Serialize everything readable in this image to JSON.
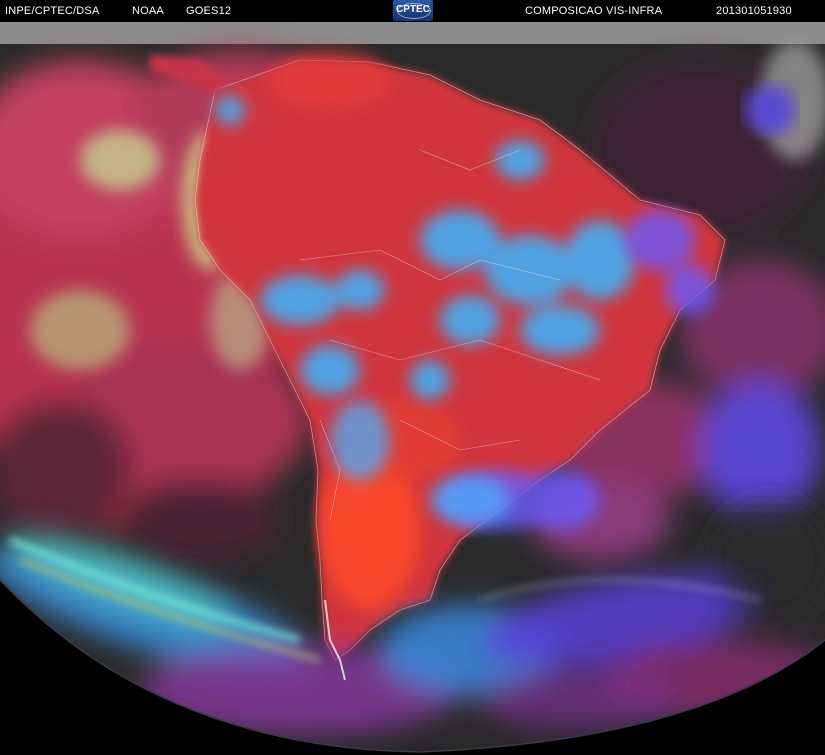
{
  "header": {
    "source": "INPE/CPTEC/DSA",
    "agency": "NOAA",
    "satellite": "GOES12",
    "logo_text": "CPTEC",
    "product": "COMPOSICAO VIS-INFRA",
    "timestamp": "201301051930"
  },
  "colors": {
    "ocean_clear": "#2a2a2a",
    "cloud_red": "#c8324a",
    "cloud_blue": "#38b8ff",
    "cloud_violet": "#6a4cff",
    "cloud_yellow": "#d7d28a",
    "space": "#000000"
  }
}
